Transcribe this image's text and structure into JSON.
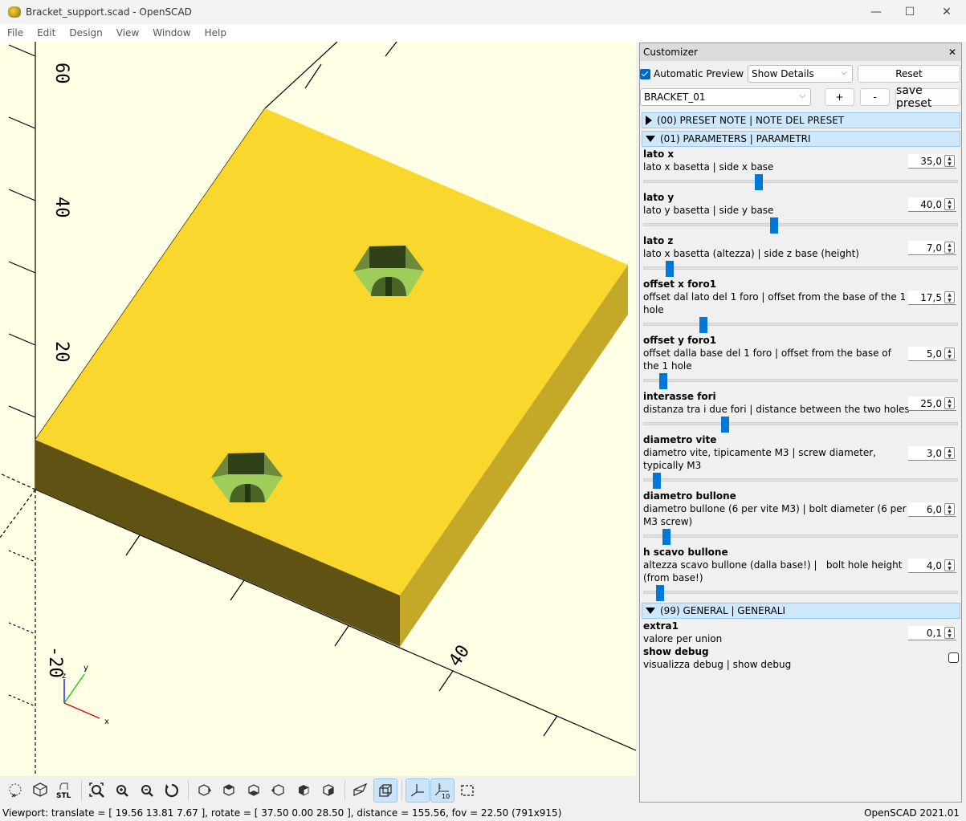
{
  "window": {
    "title": "Bracket_support.scad - OpenSCAD",
    "controls": {
      "minimize": "—",
      "maximize": "☐",
      "close": "✕"
    }
  },
  "menu": [
    "File",
    "Edit",
    "Design",
    "View",
    "Window",
    "Help"
  ],
  "viewport": {
    "axis_labels": {
      "z_top": "60",
      "z_mid": "40",
      "z_low": "20",
      "z_neg": "-20",
      "x_label": "40"
    },
    "gizmo": {
      "x": "x",
      "y": "y",
      "z": "z"
    },
    "colors": {
      "background": "#ffffe5",
      "top": "#f9d72c",
      "front": "#5f5213",
      "side": "#c4a827",
      "hole_light": "#9fcd5a",
      "hole_mid": "#6f8a3a",
      "hole_dark": "#304018"
    }
  },
  "toolbar": {
    "buttons": [
      {
        "name": "preview",
        "icon": "preview-icon"
      },
      {
        "name": "render",
        "icon": "render-icon"
      },
      {
        "name": "export-stl",
        "icon": "stl-icon",
        "label": "STL"
      },
      {
        "name": "view-all",
        "icon": "zoom-fit-icon"
      },
      {
        "name": "zoom-in",
        "icon": "zoom-in-icon"
      },
      {
        "name": "zoom-out",
        "icon": "zoom-out-icon"
      },
      {
        "name": "reset-view",
        "icon": "reset-view-icon"
      },
      {
        "name": "view-right",
        "icon": "view-right-icon"
      },
      {
        "name": "view-top",
        "icon": "view-top-icon"
      },
      {
        "name": "view-bottom",
        "icon": "view-bottom-icon"
      },
      {
        "name": "view-left",
        "icon": "view-left-icon"
      },
      {
        "name": "view-front",
        "icon": "view-front-icon"
      },
      {
        "name": "view-back",
        "icon": "view-back-icon"
      },
      {
        "name": "perspective",
        "icon": "perspective-icon"
      },
      {
        "name": "orthogonal",
        "icon": "orthogonal-icon",
        "active": true
      },
      {
        "name": "show-axes",
        "icon": "axes-icon",
        "active": true
      },
      {
        "name": "show-scale",
        "icon": "scale-markers-icon",
        "active": true,
        "label": "10"
      },
      {
        "name": "show-edges",
        "icon": "edges-icon"
      }
    ]
  },
  "status": {
    "viewport": "Viewport: translate = [ 19.56 13.81 7.67 ], rotate = [ 37.50 0.00 28.50 ], distance = 155.56, fov = 22.50 (791x915)",
    "version": "OpenSCAD 2021.01"
  },
  "customizer": {
    "title": "Customizer",
    "close": "✕",
    "automatic_preview": {
      "label": "Automatic Preview",
      "checked": true
    },
    "details_combo": "Show Details",
    "reset_label": "Reset",
    "preset_combo": "BRACKET_01",
    "add_label": "+",
    "remove_label": "-",
    "save_label": "save preset",
    "sections": [
      {
        "label": "(00) PRESET NOTE | NOTE DEL PRESET",
        "expanded": false
      },
      {
        "label": "(01) PARAMETERS | PARAMETRI",
        "expanded": true
      },
      {
        "label": "(99) GENERAL | GENERALI",
        "expanded": true
      }
    ],
    "params": [
      {
        "name": "lato x",
        "desc": "lato x basetta | side x base",
        "value": "35,0",
        "slider_fraction": 0.36
      },
      {
        "name": "lato y",
        "desc": "lato y basetta | side y base",
        "value": "40,0",
        "slider_fraction": 0.41
      },
      {
        "name": "lato z",
        "desc": "lato x basetta (altezza) | side z base (height)",
        "value": "7,0",
        "slider_fraction": 0.07
      },
      {
        "name": "offset x foro1",
        "desc": "offset dal lato del 1 foro | offset from the base of the 1 hole",
        "value": "17,5",
        "slider_fraction": 0.18
      },
      {
        "name": "offset y foro1",
        "desc": "offset dalla base del 1 foro | offset from the base of the 1 hole",
        "value": "5,0",
        "slider_fraction": 0.05
      },
      {
        "name": "interasse fori",
        "desc": "distanza tra i due fori | distance between the two holes",
        "value": "25,0",
        "slider_fraction": 0.25
      },
      {
        "name": "diametro vite",
        "desc": "diametro vite, tipicamente M3 | screw diameter, typically M3",
        "value": "3,0",
        "slider_fraction": 0.03
      },
      {
        "name": "diametro bullone",
        "desc": "diametro bullone (6 per vite M3) | bolt diameter (6 per M3 screw)",
        "value": "6,0",
        "slider_fraction": 0.06
      },
      {
        "name": "h scavo bullone",
        "desc": "altezza scavo bullone (dalla base!) |   bolt hole height (from base!)",
        "value": "4,0",
        "slider_fraction": 0.04
      }
    ],
    "general": [
      {
        "name": "extra1",
        "desc": "valore per union",
        "value": "0,1"
      },
      {
        "name": "show debug",
        "desc": "visualizza debug | show debug",
        "checked": false
      }
    ]
  }
}
